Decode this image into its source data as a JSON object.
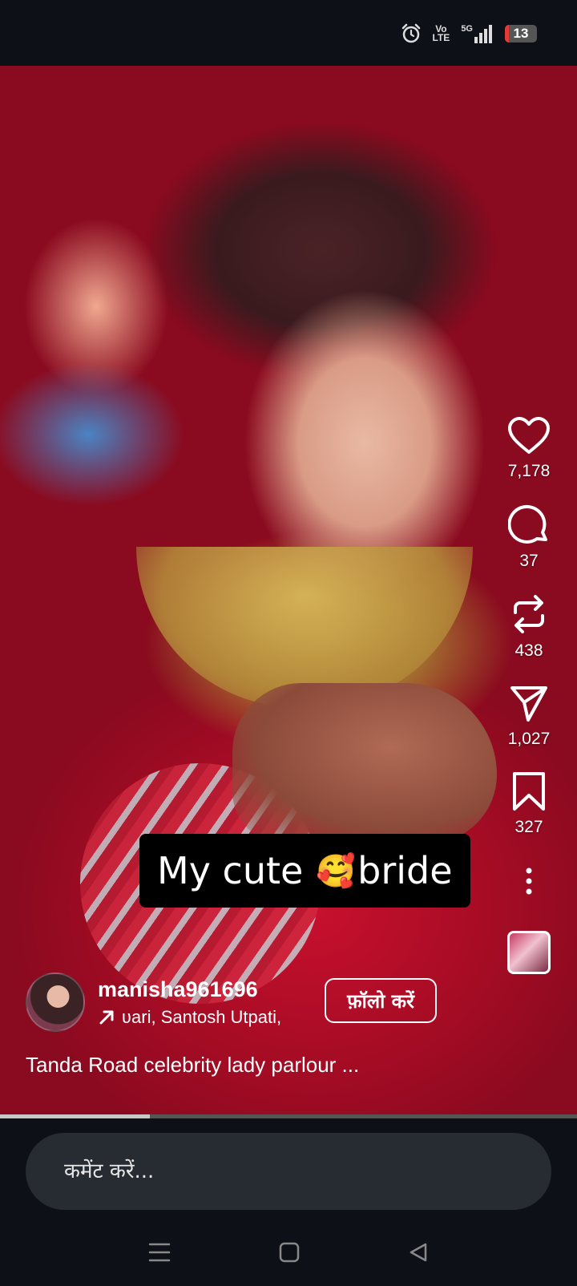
{
  "status_bar": {
    "icons": [
      "alarm-icon",
      "volte-icon",
      "signal-5g-icon"
    ],
    "volte_line1": "Vo",
    "volte_line2": "LTE",
    "network": "5G",
    "battery": "13",
    "battery_color": "#e53935"
  },
  "video": {
    "overlay_text_before": "My cute",
    "overlay_emoji": "🥰",
    "overlay_text_after": "bride",
    "progress": 0.26
  },
  "actions": {
    "like_count": "7,178",
    "comment_count": "37",
    "repost_count": "438",
    "share_count": "1,027",
    "save_count": "327"
  },
  "author": {
    "username": "manisha961696",
    "audio_text": "ʋari, Santosh Utpati,",
    "follow_label": "फ़ॉलो करें",
    "description": "Tanda Road celebrity lady parlour ..."
  },
  "comment": {
    "placeholder": "कमेंट करें..."
  },
  "nav": {
    "items": [
      "menu-icon",
      "home-icon",
      "back-icon"
    ]
  }
}
